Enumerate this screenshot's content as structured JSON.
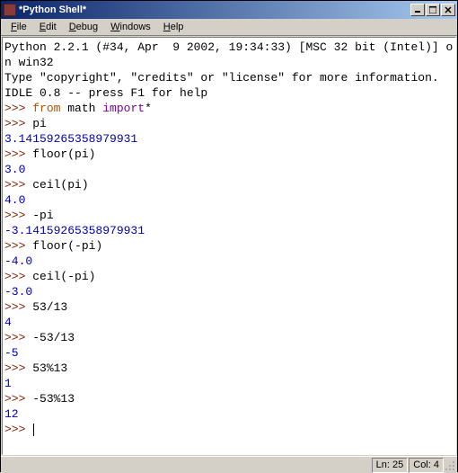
{
  "window": {
    "title": "*Python Shell*"
  },
  "menu": {
    "file": "File",
    "edit": "Edit",
    "debug": "Debug",
    "windows": "Windows",
    "help": "Help"
  },
  "shell": {
    "banner1": "Python 2.2.1 (#34, Apr  9 2002, 19:34:33) [MSC 32 bit (Intel)] on win32",
    "banner2": "Type \"copyright\", \"credits\" or \"license\" for more information.",
    "idle": "IDLE 0.8 -- press F1 for help",
    "lines": [
      {
        "in_parts": [
          "from",
          " math ",
          "import",
          "*"
        ],
        "has_out": false
      },
      {
        "in": "pi",
        "out": "3.14159265358979931",
        "out_color": "blue"
      },
      {
        "in": "floor(pi)",
        "out": "3.0",
        "out_color": "blue"
      },
      {
        "in": "ceil(pi)",
        "out": "4.0",
        "out_color": "blue"
      },
      {
        "in": "-pi",
        "out": "-3.14159265358979931",
        "out_color": "blue"
      },
      {
        "in": "floor(-pi)",
        "out": "-4.0",
        "out_color": "blue"
      },
      {
        "in": "ceil(-pi)",
        "out": "-3.0",
        "out_color": "blue"
      },
      {
        "in": "53/13",
        "out": "4",
        "out_color": "blue"
      },
      {
        "in": "-53/13",
        "out": "-5",
        "out_color": "blue"
      },
      {
        "in": "53%13",
        "out": "1",
        "out_color": "blue"
      },
      {
        "in": "-53%13",
        "out": "12",
        "out_color": "blue"
      }
    ],
    "prompt": ">>> "
  },
  "status": {
    "ln_label": "Ln: ",
    "ln": "25",
    "col_label": "Col: ",
    "col": "4"
  }
}
